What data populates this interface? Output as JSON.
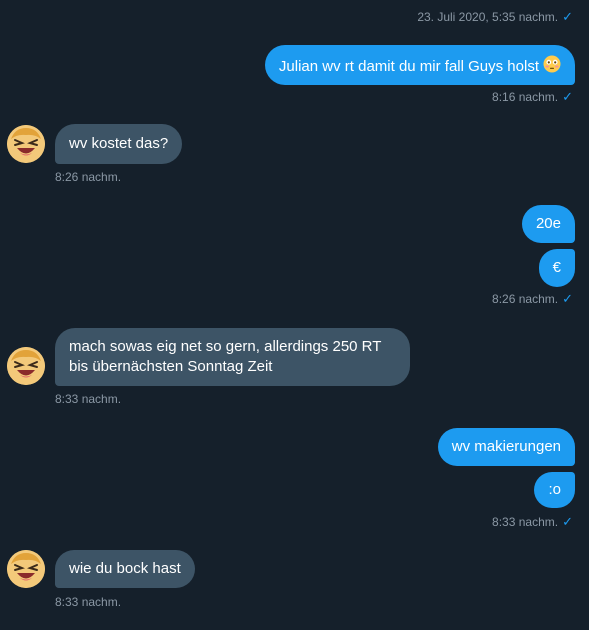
{
  "colors": {
    "background": "#15202b",
    "outgoing_bubble": "#1d9bf0",
    "incoming_bubble": "#3d5466",
    "timestamp": "#8b98a5",
    "read_check": "#1d9bf0"
  },
  "icons": {
    "avatar": "avatar-laughing-face-icon",
    "read_receipt": "checkmark-icon",
    "emoji": "flushed-face-emoji-icon"
  },
  "messages": [
    {
      "time": "23. Juli 2020, 5:35 nachm."
    },
    {
      "text": "Julian wv rt damit du mir fall Guys holst",
      "emoji": "😳",
      "time": "8:16 nachm."
    },
    {
      "text": "wv kostet das?",
      "time": "8:26 nachm."
    },
    {
      "text_1": "20e",
      "text_2": "€",
      "time": "8:26 nachm."
    },
    {
      "text_line1": "mach sowas eig net so gern, allerdings 250 RT",
      "text_line2": "bis übernächsten Sonntag Zeit",
      "time": "8:33 nachm."
    },
    {
      "text_1": "wv makierungen",
      "text_2": ":o",
      "time": "8:33 nachm."
    },
    {
      "text": "wie du bock hast",
      "time": "8:33 nachm."
    }
  ]
}
